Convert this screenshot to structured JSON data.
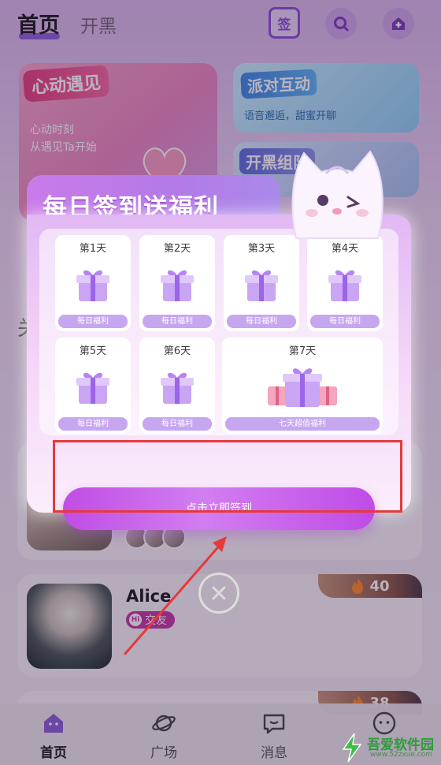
{
  "header": {
    "tab_home": "首页",
    "tab_kaihei": "开黑",
    "sign_icon_text": "签"
  },
  "banners": {
    "left": {
      "title": "心动遇见",
      "line1": "心动时刻",
      "line2": "从遇见Ta开始"
    },
    "right_top": {
      "title": "派对互动",
      "subtitle": "语音邂逅，甜蜜开聊"
    },
    "right_bottom": {
      "title": "开黑组队"
    }
  },
  "bg_text": "关",
  "users": [
    {
      "name": "",
      "heat": ""
    },
    {
      "name": "Alice",
      "tag": "交友",
      "tag_prefix": "Hi",
      "heat": "40"
    },
    {
      "name": "",
      "heat": "38"
    }
  ],
  "modal": {
    "title": "每日签到送福利",
    "days": [
      {
        "label": "第1天",
        "reward": "每日福利"
      },
      {
        "label": "第2天",
        "reward": "每日福利"
      },
      {
        "label": "第3天",
        "reward": "每日福利"
      },
      {
        "label": "第4天",
        "reward": "每日福利"
      },
      {
        "label": "第5天",
        "reward": "每日福利"
      },
      {
        "label": "第6天",
        "reward": "每日福利"
      },
      {
        "label": "第7天",
        "reward": "七天超值福利"
      }
    ],
    "sign_button": "点击立即签到"
  },
  "bottom_nav": {
    "items": [
      {
        "label": "首页",
        "icon": "home-icon",
        "active": true
      },
      {
        "label": "广场",
        "icon": "planet-icon",
        "active": false
      },
      {
        "label": "消息",
        "icon": "message-icon",
        "active": false
      },
      {
        "label": "",
        "icon": "profile-icon",
        "active": false
      }
    ]
  },
  "watermark": {
    "title": "吾爱软件园",
    "url": "www.52zxue.com"
  },
  "colors": {
    "accent": "#7a4bd6",
    "sign_button": "#c04de5",
    "highlight": "#e53a3a"
  }
}
